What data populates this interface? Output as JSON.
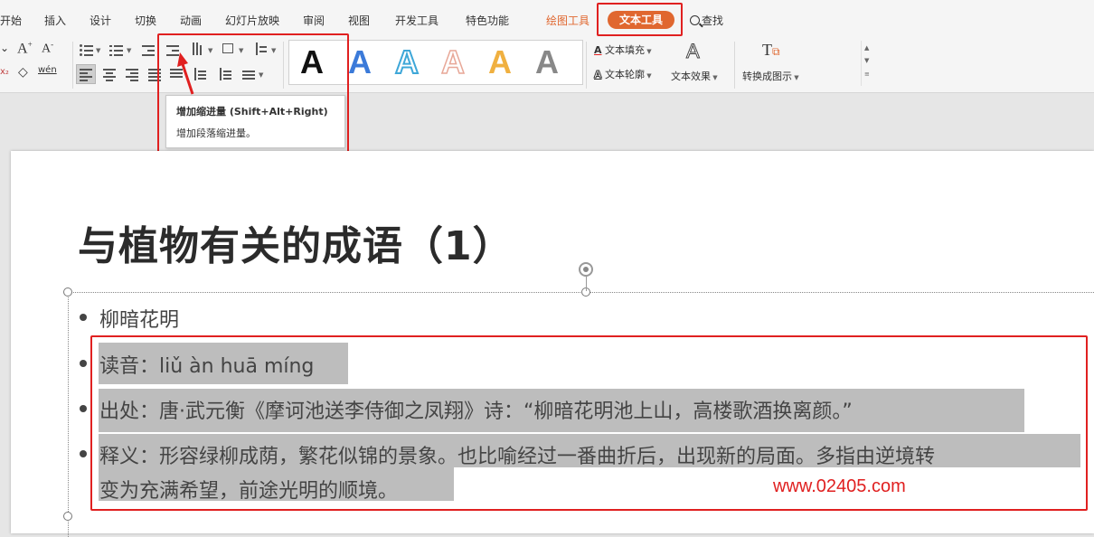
{
  "menu": {
    "items": [
      "开始",
      "插入",
      "设计",
      "切换",
      "动画",
      "幻灯片放映",
      "审阅",
      "视图",
      "开发工具",
      "特色功能"
    ],
    "drawing_tool": "绘图工具",
    "text_tool": "文本工具",
    "search": "查找"
  },
  "ribbon": {
    "text_fill": "文本填充",
    "text_outline": "文本轮廓",
    "text_effect": "文本效果",
    "convert_to_smartart": "转换成图示",
    "font_grow": "A",
    "font_shrink": "A",
    "clear_format_label": "wén",
    "gallery_letters": [
      "A",
      "A",
      "A",
      "A",
      "A",
      "A"
    ],
    "gallery_colors": [
      "#111111",
      "#3b7ad9",
      "#3ea7d8",
      "#e8a898",
      "#f0b040",
      "#888888"
    ]
  },
  "tooltip": {
    "title": "增加缩进量 (Shift+Alt+Right)",
    "desc": "增加段落缩进量。"
  },
  "slide": {
    "title": "与植物有关的成语（1）",
    "bullets": [
      "柳暗花明",
      "读音：liǔ àn huā míng",
      "出处：唐·武元衡《摩诃池送李侍御之凤翔》诗：“柳暗花明池上山，高楼歌酒换离颜。”",
      "释义：形容绿柳成荫，繁花似锦的景象。也比喻经过一番曲折后，出现新的局面。多指由逆境转",
      "变为充满希望，前途光明的顺境。"
    ]
  },
  "watermark": "www.02405.com",
  "colors": {
    "accent": "#e0672f",
    "highlight_box": "#e02020",
    "selection": "#bdbdbd"
  }
}
